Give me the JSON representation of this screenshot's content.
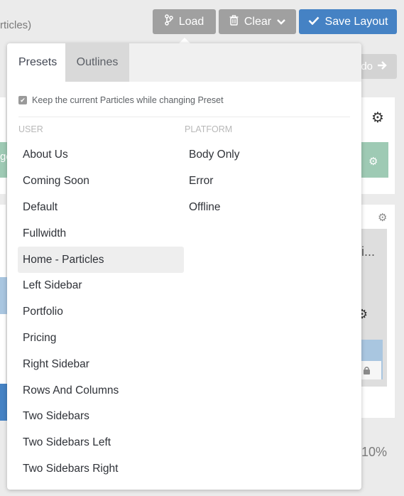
{
  "background": {
    "title_fragment": "rticles)",
    "toolbar": {
      "load_label": "Load",
      "clear_label": "Clear",
      "save_label": "Save Layout",
      "redo_label": "do"
    },
    "partial_texts": {
      "left_edge_1": "ge",
      "right_block": "i...",
      "percent": "10%"
    }
  },
  "dropdown": {
    "tabs": [
      {
        "label": "Presets",
        "active": true
      },
      {
        "label": "Outlines",
        "active": false
      }
    ],
    "keep_particles": {
      "checked": true,
      "label": "Keep the current Particles while changing Preset"
    },
    "user_heading": "USER",
    "platform_heading": "PLATFORM",
    "user_items": [
      "About Us",
      "Coming Soon",
      "Default",
      "Fullwidth",
      "Home - Particles",
      "Left Sidebar",
      "Portfolio",
      "Pricing",
      "Right Sidebar",
      "Rows And Columns",
      "Two Sidebars",
      "Two Sidebars Left",
      "Two Sidebars Right"
    ],
    "selected_user_item": "Home - Particles",
    "platform_items": [
      "Body Only",
      "Error",
      "Offline"
    ]
  },
  "colors": {
    "save_button": "#4582c4",
    "neutral_button": "#a0a0a0",
    "selected_row": "#eeeeee"
  }
}
